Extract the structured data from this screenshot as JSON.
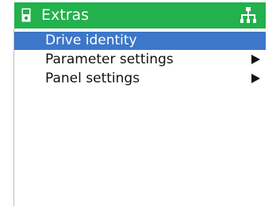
{
  "header": {
    "title": "Extras",
    "left_icon": "device-icon",
    "right_icon": "network-hierarchy-icon",
    "background_color": "#22b14c"
  },
  "menu": {
    "items": [
      {
        "label": "Drive identity",
        "selected": true,
        "has_submenu": false
      },
      {
        "label": "Parameter settings",
        "selected": false,
        "has_submenu": true,
        "submenu_icon": "play-arrow-icon"
      },
      {
        "label": "Panel settings",
        "selected": false,
        "has_submenu": true,
        "submenu_icon": "play-arrow-icon"
      }
    ],
    "selected_background": "#3d77c9"
  }
}
